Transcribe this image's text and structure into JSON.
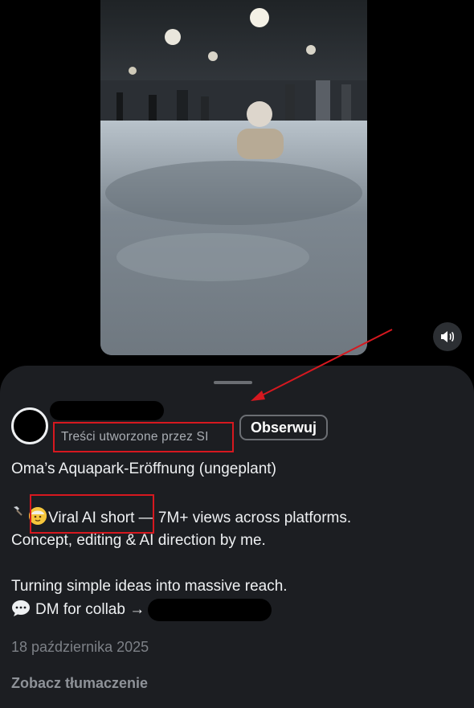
{
  "post": {
    "ai_label": "Treści utworzone przez SI",
    "follow_label": "Obserwuj",
    "caption_title": "Oma’s Aquapark-Eröffnung (ungeplant)",
    "line_viral": "Viral AI short",
    "line_views": " — 7M+ views across platforms.",
    "line_concept": "Concept, editing & AI direction by me.",
    "line_turning": "Turning simple ideas into massive reach.",
    "line_dm": "DM for collab →",
    "date": "18 października 2025",
    "translate": "Zobacz tłumaczenie"
  },
  "icons": {
    "speaker": "speaker-icon",
    "hammer": "hammer-icon",
    "face": "older-woman-emoji-icon",
    "speech": "speech-bubble-icon"
  },
  "colors": {
    "sheet_bg": "#1c1e22",
    "annotation_red": "#d6181f",
    "muted_text": "#7d8187"
  }
}
